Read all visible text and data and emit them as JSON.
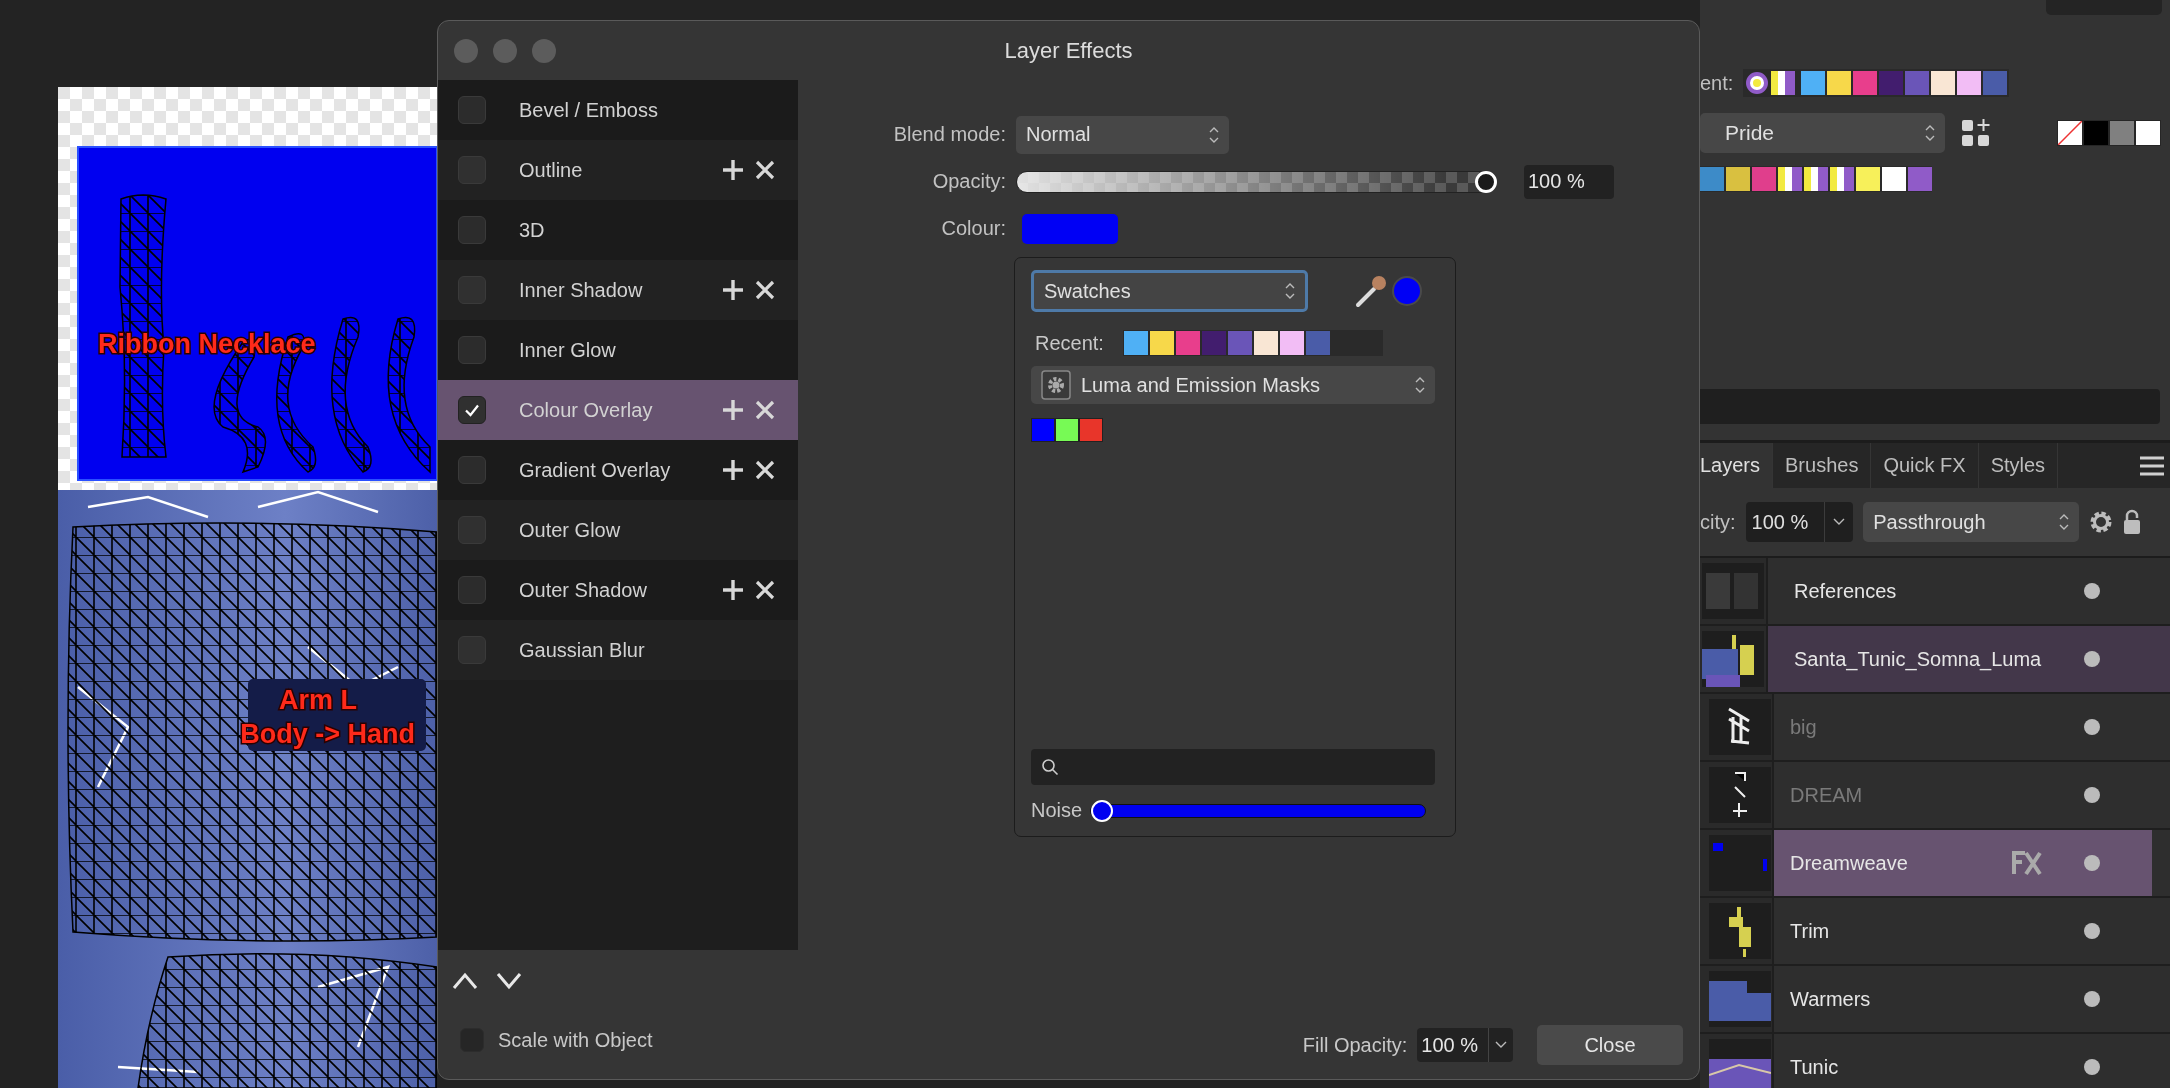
{
  "canvas": {
    "labels": [
      {
        "text": "Ribbon Necklace"
      },
      {
        "text": "Arm L"
      },
      {
        "text": "Body -> Hand"
      }
    ]
  },
  "dialog": {
    "title": "Layer Effects",
    "effects": [
      {
        "label": "Bevel / Emboss",
        "checked": false,
        "selected": false,
        "stackable": false
      },
      {
        "label": "Outline",
        "checked": false,
        "selected": false,
        "stackable": true
      },
      {
        "label": "3D",
        "checked": false,
        "selected": false,
        "stackable": false
      },
      {
        "label": "Inner Shadow",
        "checked": false,
        "selected": false,
        "stackable": true
      },
      {
        "label": "Inner Glow",
        "checked": false,
        "selected": false,
        "stackable": false
      },
      {
        "label": "Colour Overlay",
        "checked": true,
        "selected": true,
        "stackable": true
      },
      {
        "label": "Gradient Overlay",
        "checked": false,
        "selected": false,
        "stackable": true
      },
      {
        "label": "Outer Glow",
        "checked": false,
        "selected": false,
        "stackable": false
      },
      {
        "label": "Outer Shadow",
        "checked": false,
        "selected": false,
        "stackable": true
      },
      {
        "label": "Gaussian Blur",
        "checked": false,
        "selected": false,
        "stackable": false
      }
    ],
    "blend_mode": {
      "label": "Blend mode:",
      "value": "Normal"
    },
    "opacity": {
      "label": "Opacity:",
      "level": 1,
      "reading": "100 %"
    },
    "colour": {
      "label": "Colour:",
      "color": "#0000f5"
    },
    "picker": {
      "source": "Swatches",
      "recent_label": "Recent:",
      "recent": [
        {
          "kind": "solid",
          "color": "#4fb0f5"
        },
        {
          "kind": "solid",
          "color": "#f7d84a"
        },
        {
          "kind": "solid",
          "color": "#e83e8c"
        },
        {
          "kind": "solid",
          "color": "#421d6e"
        },
        {
          "kind": "solid",
          "color": "#6a55b8"
        },
        {
          "kind": "solid",
          "color": "#f9e6d4"
        },
        {
          "kind": "solid",
          "color": "#f2bdf5"
        },
        {
          "kind": "solid",
          "color": "#4a5ca8"
        }
      ],
      "palette": "Luma and Emission Masks",
      "swatches": [
        {
          "kind": "solid",
          "color": "#0000ff"
        },
        {
          "kind": "solid",
          "color": "#77fa55"
        },
        {
          "kind": "solid",
          "color": "#e8352a"
        }
      ],
      "noise": {
        "label": "Noise",
        "level": 0
      }
    },
    "scale_with_object": {
      "label": "Scale with Object",
      "checked": false
    },
    "fill_opacity": {
      "label": "Fill Opacity:",
      "value": "100 %"
    },
    "close_button": "Close"
  },
  "right_panel": {
    "recent_label": "ent:",
    "recent": [
      {
        "kind": "ring"
      },
      {
        "kind": "stripe"
      },
      {
        "kind": "solid",
        "color": "#4fb0f5"
      },
      {
        "kind": "solid",
        "color": "#f7d84a"
      },
      {
        "kind": "solid",
        "color": "#e83e8c"
      },
      {
        "kind": "solid",
        "color": "#421d6e"
      },
      {
        "kind": "solid",
        "color": "#6a55b8"
      },
      {
        "kind": "solid",
        "color": "#f9e6d4"
      },
      {
        "kind": "solid",
        "color": "#f2bdf5"
      },
      {
        "kind": "solid",
        "color": "#4a5ca8"
      }
    ],
    "palette": "Pride",
    "defaults": [
      {
        "kind": "none"
      },
      {
        "kind": "solid",
        "color": "#000000"
      },
      {
        "kind": "solid",
        "color": "#808080"
      },
      {
        "kind": "solid",
        "color": "#ffffff"
      }
    ],
    "palette_swatches": [
      {
        "kind": "solid",
        "color": "#3d8bc8"
      },
      {
        "kind": "solid",
        "color": "#d9c040"
      },
      {
        "kind": "solid",
        "color": "#e03e8c"
      },
      {
        "kind": "stripe"
      },
      {
        "kind": "stripe"
      },
      {
        "kind": "stripe"
      },
      {
        "kind": "solid",
        "color": "#f7f05a"
      },
      {
        "kind": "solid",
        "color": "#ffffff"
      },
      {
        "kind": "solid",
        "color": "#905bc8"
      }
    ],
    "tabs": [
      {
        "label": "Layers",
        "selected": true
      },
      {
        "label": "Brushes",
        "selected": false
      },
      {
        "label": "Quick FX",
        "selected": false
      },
      {
        "label": "Styles",
        "selected": false
      }
    ],
    "opacity_label": "city:",
    "opacity": "100 %",
    "blend_mode": "Passthrough",
    "layers": [
      {
        "name": "References",
        "selected": false,
        "disabled": false,
        "fx": false
      },
      {
        "name": "Santa_Tunic_Somna_Luma",
        "selected": false,
        "disabled": false,
        "fx": false,
        "children": [
          {
            "name": "big",
            "selected": false,
            "disabled": true,
            "fx": false
          },
          {
            "name": "DREAM",
            "selected": false,
            "disabled": true,
            "fx": false
          },
          {
            "name": "Dreamweave",
            "selected": true,
            "disabled": false,
            "fx": true
          },
          {
            "name": "Trim",
            "selected": false,
            "disabled": false,
            "fx": false
          },
          {
            "name": "Warmers",
            "selected": false,
            "disabled": false,
            "fx": false
          },
          {
            "name": "Tunic",
            "selected": false,
            "disabled": false,
            "fx": false
          }
        ]
      }
    ]
  }
}
